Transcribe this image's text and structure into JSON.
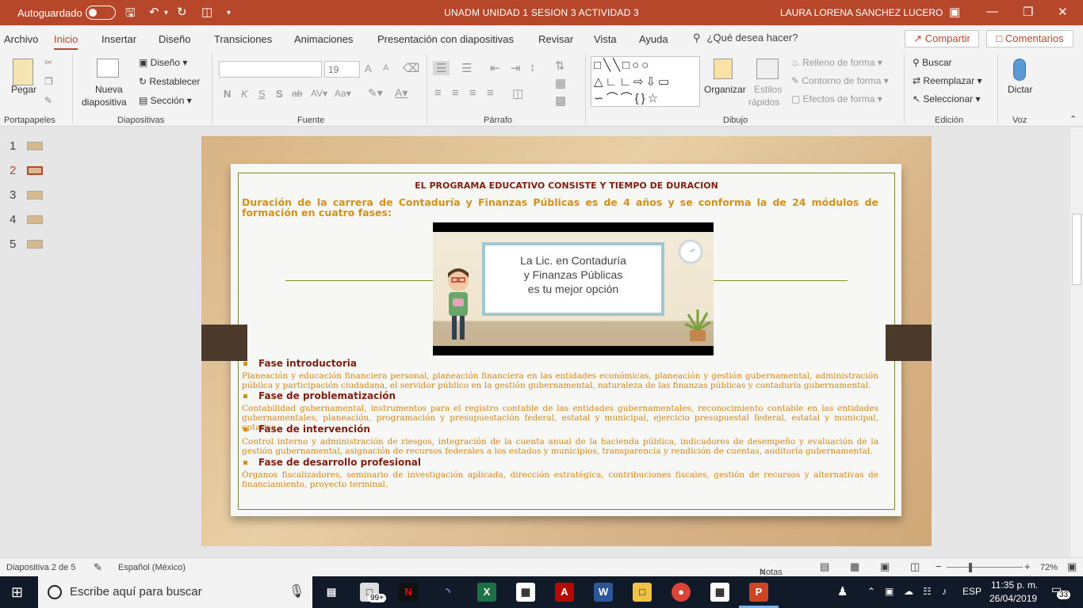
{
  "titlebar": {
    "autosave_label": "Autoguardado",
    "document_title": "UNADM UNIDAD 1 SESION 3 ACTIVIDAD 3",
    "user_name": "LAURA LORENA SANCHEZ LUCERO"
  },
  "ribbon_tabs": [
    "Archivo",
    "Inicio",
    "Insertar",
    "Diseño",
    "Transiciones",
    "Animaciones",
    "Presentación con diapositivas",
    "Revisar",
    "Vista",
    "Ayuda"
  ],
  "active_tab": "Inicio",
  "tell_me": "¿Qué desea hacer?",
  "share_label": "Compartir",
  "comments_label": "Comentarios",
  "ribbon": {
    "clipboard": {
      "paste": "Pegar",
      "label": "Portapapeles"
    },
    "slides": {
      "new_slide_1": "Nueva",
      "new_slide_2": "diapositiva",
      "layout": "Diseño",
      "reset": "Restablecer",
      "section": "Sección",
      "label": "Diapositivas"
    },
    "font": {
      "size": "19",
      "label": "Fuente",
      "bold": "N",
      "italic": "K",
      "underline": "S",
      "shadow": "S",
      "strike": "ab",
      "case": "Aa",
      "grow": "A",
      "shrink": "A"
    },
    "paragraph": {
      "label": "Párrafo"
    },
    "drawing": {
      "arrange": "Organizar",
      "quick_styles_1": "Estilos",
      "quick_styles_2": "rápidos",
      "shape_fill": "Relleno de forma",
      "shape_outline": "Contorno de forma",
      "shape_effects": "Efectos de forma",
      "label": "Dibujo"
    },
    "editing": {
      "find": "Buscar",
      "replace": "Reemplazar",
      "select": "Seleccionar",
      "label": "Edición"
    },
    "voice": {
      "dictate": "Dictar",
      "label": "Voz"
    }
  },
  "thumbnails": [
    {
      "num": "1",
      "active": false
    },
    {
      "num": "2",
      "active": true
    },
    {
      "num": "3",
      "active": false
    },
    {
      "num": "4",
      "active": false
    },
    {
      "num": "5",
      "active": false
    }
  ],
  "slide": {
    "title": "EL PROGRAMA EDUCATIVO CONSISTE Y TIEMPO DE DURACION",
    "subtitle": "Duración de la carrera de Contaduría y Finanzas Públicas es de 4 años y se conforma la de 24 módulos de formación en cuatro fases:",
    "video_text": [
      "La Lic. en Contaduría",
      "y Finanzas Públicas",
      "es tu mejor opción"
    ],
    "phases": [
      {
        "heading": "Fase introductoria",
        "text": "Planeación y educación financiera personal, planeación financiera en las entidades económicas, planeación y gestión gubernamental, administración pública y participación ciudadana, el servidor público en la gestión gubernamental, naturaleza de las finanzas públicas y contaduría gubernamental."
      },
      {
        "heading": "Fase de problematización",
        "text": "Contabilidad gubernamental, instrumentos para el registro contable de las entidades gubernamentales, reconocimiento contable en las entidades gubernamentales, planeación, programación y presupuestación federal, estatal y municipal, ejercicio presupuestal federal, estatal y municipal, optativa."
      },
      {
        "heading": "Fase de intervención",
        "text": "Control interno y administración de riesgos, integración de la cuenta anual de la hacienda pública, indicadores de desempeño y evaluación de la gestión gubernamental, asignación de recursos federales a los estados y municipios, transparencia y rendición de cuentas, auditoría gubernamental."
      },
      {
        "heading": "Fase de desarrollo profesional",
        "text": "Órganos fiscalizadores, seminario de investigación aplicada, dirección estratégica, contribuciones fiscales, gestión de recursos y alternativas de financiamiento, proyecto terminal."
      }
    ]
  },
  "statusbar": {
    "slide_info": "Diapositiva 2 de 5",
    "language": "Español (México)",
    "notes": "Notas",
    "zoom": "72%"
  },
  "taskbar": {
    "search_placeholder": "Escribe aquí para buscar",
    "badge": "99+",
    "lang": "ESP",
    "time": "11:35 p. m.",
    "date": "26/04/2019",
    "notif_count": "33"
  },
  "colors": {
    "accent": "#b7472a",
    "slide_title": "#7f1f12",
    "slide_subtitle": "#d59115",
    "slide_body": "#d58512",
    "frame": "#7e8b2d"
  }
}
